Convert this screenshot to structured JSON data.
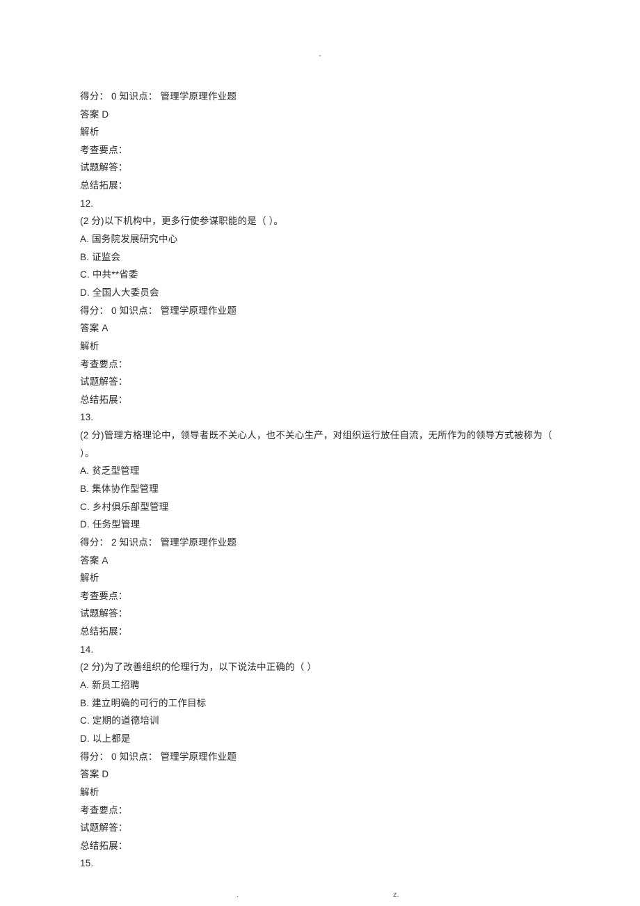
{
  "header_mark": "-",
  "footer_dot": ".",
  "footer_z": "z.",
  "blocks": {
    "b11_tail": {
      "score_line": "得分： 0 知识点： 管理学原理作业题",
      "answer": "答案  D",
      "analysis": "解析",
      "exam_point": "考查要点：",
      "solution": "试题解答：",
      "summary": "总结拓展："
    },
    "q12": {
      "num": "12.",
      "stem": "(2 分)以下机构中，更多行使参谋职能的是（ ）。",
      "options": [
        "A.  国务院发展研究中心",
        "B.  证监会",
        "C.  中共**省委",
        "D.  全国人大委员会"
      ],
      "score_line": "得分： 0 知识点： 管理学原理作业题",
      "answer": "答案  A",
      "analysis": "解析",
      "exam_point": "考查要点：",
      "solution": "试题解答：",
      "summary": "总结拓展："
    },
    "q13": {
      "num": "13.",
      "stem": "(2 分)管理方格理论中，领导者既不关心人，也不关心生产，对组织运行放任自流，无所作为的领导方式被称为（ ）。",
      "options": [
        "A.  贫乏型管理",
        "B.  集体协作型管理",
        "C.  乡村俱乐部型管理",
        "D.  任务型管理"
      ],
      "score_line": "得分： 2 知识点： 管理学原理作业题",
      "answer": "答案  A",
      "analysis": "解析",
      "exam_point": "考查要点：",
      "solution": "试题解答：",
      "summary": "总结拓展："
    },
    "q14": {
      "num": "14.",
      "stem": "(2 分)为了改善组织的伦理行为，以下说法中正确的（ ）",
      "options": [
        "A.  新员工招聘",
        "B.  建立明确的可行的工作目标",
        "C.  定期的道德培训",
        "D.  以上都是"
      ],
      "score_line": "得分： 0 知识点： 管理学原理作业题",
      "answer": "答案  D",
      "analysis": "解析",
      "exam_point": "考查要点：",
      "solution": "试题解答：",
      "summary": "总结拓展："
    },
    "q15": {
      "num": "15."
    }
  }
}
